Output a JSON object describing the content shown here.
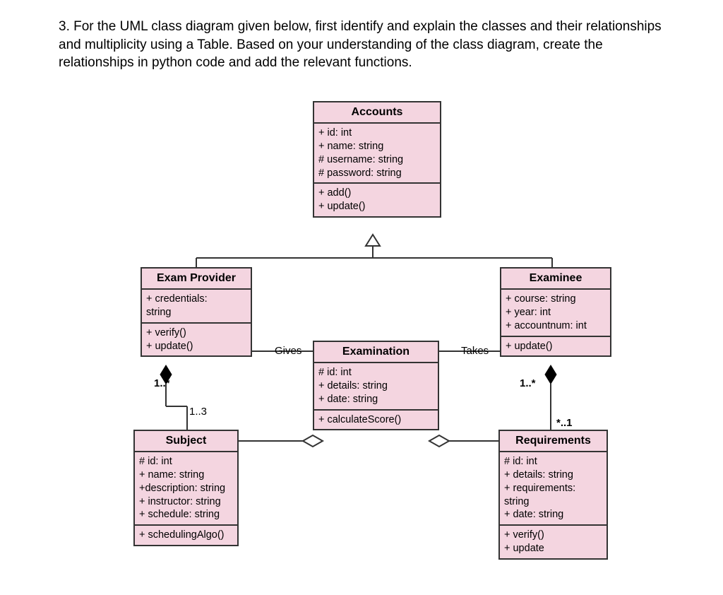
{
  "question": "3. For the UML class diagram given below, first identify and explain the classes and their relationships and multiplicity using a Table. Based on your understanding of the class diagram, create the relationships in python code and add the relevant functions.",
  "classes": {
    "accounts": {
      "name": "Accounts",
      "attrs": [
        "+ id: int",
        "+ name: string",
        "# username: string",
        "# password: string"
      ],
      "ops": [
        "+ add()",
        "+ update()"
      ]
    },
    "examProvider": {
      "name": "Exam Provider",
      "attrs": [
        "+ credentials: string"
      ],
      "ops": [
        "+ verify()",
        "+ update()"
      ]
    },
    "examinee": {
      "name": "Examinee",
      "attrs": [
        "+ course: string",
        "+ year: int",
        "+ accountnum: int"
      ],
      "ops": [
        "+ update()"
      ]
    },
    "examination": {
      "name": "Examination",
      "attrs": [
        "# id: int",
        "+ details: string",
        "+ date: string"
      ],
      "ops": [
        "+ calculateScore()"
      ]
    },
    "subject": {
      "name": "Subject",
      "attrs": [
        "# id: int",
        "+ name: string",
        "+description: string",
        "+ instructor: string",
        "+ schedule: string"
      ],
      "ops": [
        "+ schedulingAlgo()"
      ]
    },
    "requirements": {
      "name": "Requirements",
      "attrs": [
        "# id: int",
        "+ details: string",
        "+ requirements: string",
        "+ date: string"
      ],
      "ops": [
        "+ verify()",
        "+ update"
      ]
    }
  },
  "labels": {
    "gives": "Gives",
    "takes": "Takes",
    "m_1star_left": "1..*",
    "m_1star_right": "1..*",
    "m_1_3": "1..3",
    "m_star_1": "*..1"
  }
}
